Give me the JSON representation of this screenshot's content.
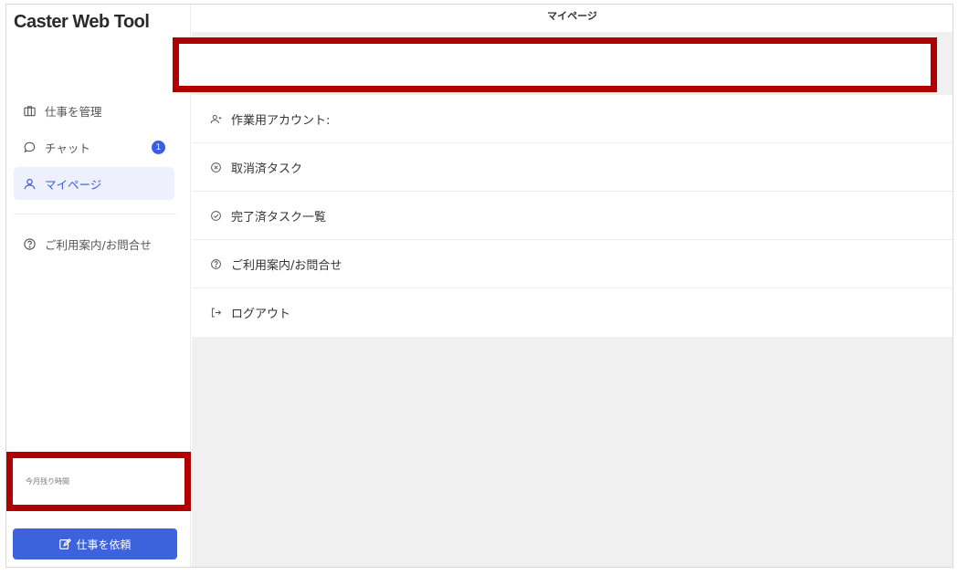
{
  "app": {
    "title": "Caster Web Tool"
  },
  "header": {
    "title": "マイページ"
  },
  "sidebar": {
    "items": [
      {
        "label": "仕事を管理",
        "icon": "briefcase-icon"
      },
      {
        "label": "チャット",
        "icon": "chat-icon",
        "badge": "1"
      },
      {
        "label": "マイページ",
        "icon": "user-icon",
        "active": true
      },
      {
        "label": "ご利用案内/お問合せ",
        "icon": "help-icon"
      }
    ],
    "remaining_hours_label": "今月残り時間",
    "request_button": "仕事を依頼"
  },
  "menu": {
    "items": [
      {
        "label": "作業用アカウント:",
        "icon": "account-icon"
      },
      {
        "label": "取消済タスク",
        "icon": "cancel-circle-icon"
      },
      {
        "label": "完了済タスク一覧",
        "icon": "check-circle-icon"
      },
      {
        "label": "ご利用案内/お問合せ",
        "icon": "help-icon"
      },
      {
        "label": "ログアウト",
        "icon": "logout-icon"
      }
    ]
  },
  "colors": {
    "accent": "#3c63db",
    "highlight_border": "#b00000",
    "active_bg": "#eef1fd"
  }
}
